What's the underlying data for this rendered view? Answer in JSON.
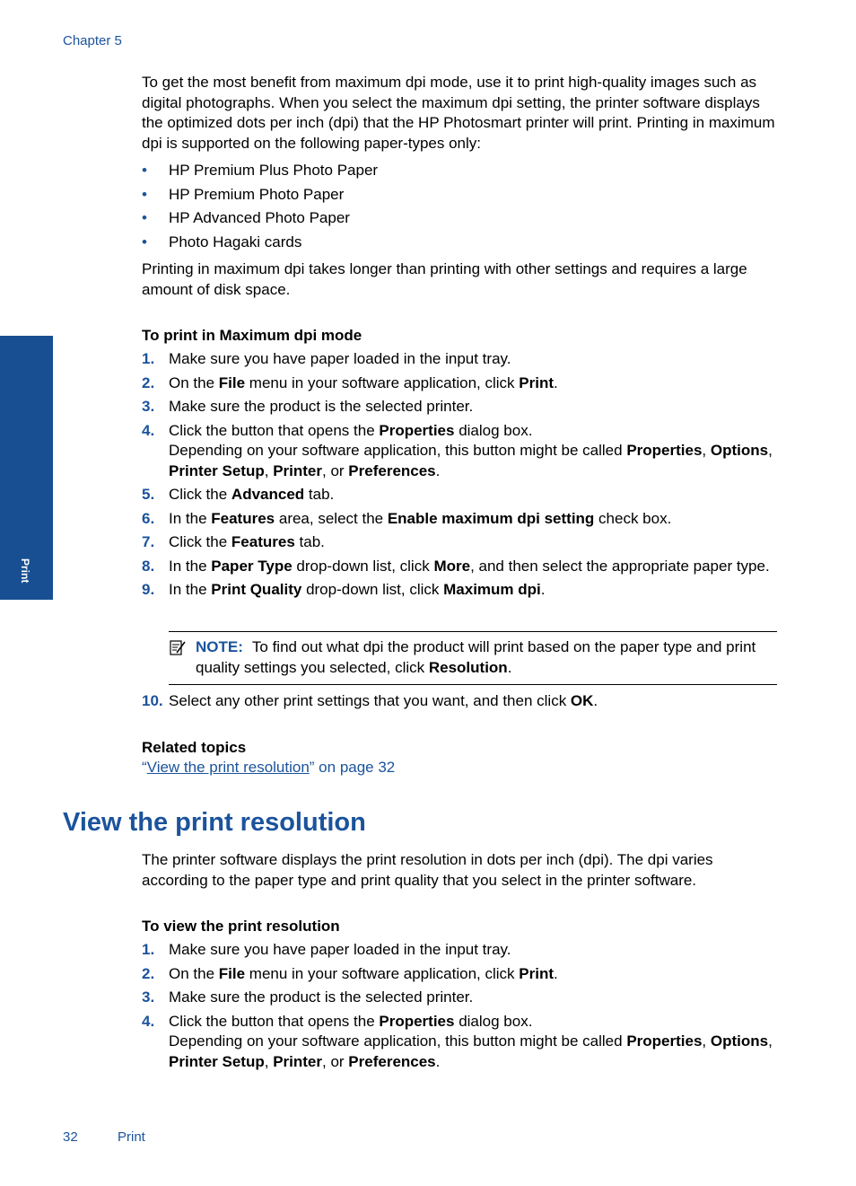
{
  "header": {
    "chapter": "Chapter 5"
  },
  "side_tab": {
    "label": "Print"
  },
  "intro": {
    "paragraph": "To get the most benefit from maximum dpi mode, use it to print high-quality images such as digital photographs. When you select the maximum dpi setting, the printer software displays the optimized dots per inch (dpi) that the HP Photosmart printer will print. Printing in maximum dpi is supported on the following paper-types only:",
    "bullets": [
      "HP Premium Plus Photo Paper",
      "HP Premium Photo Paper",
      "HP Advanced Photo Paper",
      "Photo Hagaki cards"
    ],
    "after": "Printing in maximum dpi takes longer than printing with other settings and requires a large amount of disk space."
  },
  "procedure1": {
    "title": "To print in Maximum dpi mode",
    "steps": [
      {
        "num": "1.",
        "parts": [
          [
            "Make sure you have paper loaded in the input tray.",
            false
          ]
        ]
      },
      {
        "num": "2.",
        "parts": [
          [
            "On the ",
            false
          ],
          [
            "File",
            true
          ],
          [
            " menu in your software application, click ",
            false
          ],
          [
            "Print",
            true
          ],
          [
            ".",
            false
          ]
        ]
      },
      {
        "num": "3.",
        "parts": [
          [
            "Make sure the product is the selected printer.",
            false
          ]
        ]
      },
      {
        "num": "4.",
        "parts": [
          [
            "Click the button that opens the ",
            false
          ],
          [
            "Properties",
            true
          ],
          [
            " dialog box.",
            false
          ]
        ],
        "sub": [
          [
            "Depending on your software application, this button might be called ",
            false
          ],
          [
            "Properties",
            true
          ],
          [
            ", ",
            false
          ],
          [
            "Options",
            true
          ],
          [
            ", ",
            false
          ],
          [
            "Printer Setup",
            true
          ],
          [
            ", ",
            false
          ],
          [
            "Printer",
            true
          ],
          [
            ", or ",
            false
          ],
          [
            "Preferences",
            true
          ],
          [
            ".",
            false
          ]
        ]
      },
      {
        "num": "5.",
        "parts": [
          [
            "Click the ",
            false
          ],
          [
            "Advanced",
            true
          ],
          [
            " tab.",
            false
          ]
        ]
      },
      {
        "num": "6.",
        "parts": [
          [
            "In the ",
            false
          ],
          [
            "Features",
            true
          ],
          [
            " area, select the ",
            false
          ],
          [
            "Enable maximum dpi setting",
            true
          ],
          [
            " check box.",
            false
          ]
        ]
      },
      {
        "num": "7.",
        "parts": [
          [
            "Click the ",
            false
          ],
          [
            "Features",
            true
          ],
          [
            " tab.",
            false
          ]
        ]
      },
      {
        "num": "8.",
        "parts": [
          [
            "In the ",
            false
          ],
          [
            "Paper Type",
            true
          ],
          [
            " drop-down list, click ",
            false
          ],
          [
            "More",
            true
          ],
          [
            ", and then select the appropriate paper type.",
            false
          ]
        ]
      },
      {
        "num": "9.",
        "parts": [
          [
            "In the ",
            false
          ],
          [
            "Print Quality",
            true
          ],
          [
            " drop-down list, click ",
            false
          ],
          [
            "Maximum dpi",
            true
          ],
          [
            ".",
            false
          ]
        ]
      }
    ],
    "note": {
      "label": "NOTE:",
      "parts": [
        [
          "To find out what dpi the product will print based on the paper type and print quality settings you selected, click ",
          false
        ],
        [
          "Resolution",
          true
        ],
        [
          ".",
          false
        ]
      ]
    },
    "step10": {
      "num": "10.",
      "parts": [
        [
          "Select any other print settings that you want, and then click ",
          false
        ],
        [
          "OK",
          true
        ],
        [
          ".",
          false
        ]
      ]
    }
  },
  "related": {
    "title": "Related topics",
    "link_open_quote": "“",
    "link_text": "View the print resolution",
    "link_suffix": "” on page 32"
  },
  "section": {
    "title": "View the print resolution",
    "paragraph": "The printer software displays the print resolution in dots per inch (dpi). The dpi varies according to the paper type and print quality that you select in the printer software."
  },
  "procedure2": {
    "title": "To view the print resolution",
    "steps": [
      {
        "num": "1.",
        "parts": [
          [
            "Make sure you have paper loaded in the input tray.",
            false
          ]
        ]
      },
      {
        "num": "2.",
        "parts": [
          [
            "On the ",
            false
          ],
          [
            "File",
            true
          ],
          [
            " menu in your software application, click ",
            false
          ],
          [
            "Print",
            true
          ],
          [
            ".",
            false
          ]
        ]
      },
      {
        "num": "3.",
        "parts": [
          [
            "Make sure the product is the selected printer.",
            false
          ]
        ]
      },
      {
        "num": "4.",
        "parts": [
          [
            "Click the button that opens the ",
            false
          ],
          [
            "Properties",
            true
          ],
          [
            " dialog box.",
            false
          ]
        ],
        "sub": [
          [
            "Depending on your software application, this button might be called ",
            false
          ],
          [
            "Properties",
            true
          ],
          [
            ", ",
            false
          ],
          [
            "Options",
            true
          ],
          [
            ", ",
            false
          ],
          [
            "Printer Setup",
            true
          ],
          [
            ", ",
            false
          ],
          [
            "Printer",
            true
          ],
          [
            ", or ",
            false
          ],
          [
            "Preferences",
            true
          ],
          [
            ".",
            false
          ]
        ]
      }
    ]
  },
  "footer": {
    "page_number": "32",
    "section": "Print"
  }
}
